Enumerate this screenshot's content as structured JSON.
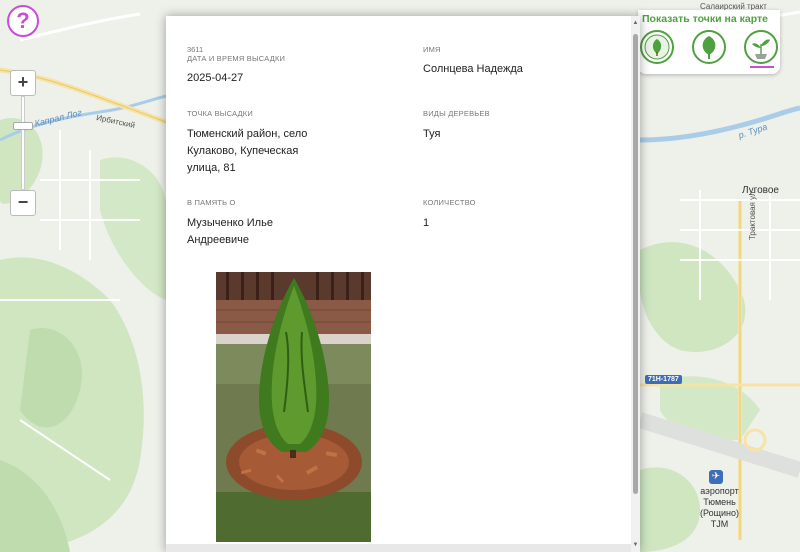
{
  "app": {
    "help_label": "?",
    "zoom_in_label": "+",
    "zoom_out_label": "−"
  },
  "points_panel": {
    "title": "Показать точки на карте",
    "icons": [
      "badge-icon",
      "tree-icon",
      "sapling-icon"
    ],
    "accent_color": "#4fa041",
    "active_underline_color": "#c64fd6"
  },
  "map": {
    "labels": {
      "road_irbit": "Ирбитский",
      "river_kapral": "Капрал Лог",
      "tract": "Салаирский тракт",
      "river_tura": "р. Тура",
      "lugovoe": "Луговое",
      "traktovaya": "Трактовая ул.",
      "road_code": "71Н-1787",
      "airport": "аэропорт\nТюмень\n(Рощино)\nTJM"
    }
  },
  "record": {
    "id": "3611",
    "planting_date_label": "Дата и время высадки",
    "planting_date": "2025-04-27",
    "name_label": "Имя",
    "name": "Солнцева Надежда",
    "location_label": "Точка высадки",
    "location": "Тюменский район, село Кулаково, Купеческая улица, 81",
    "tree_kind_label": "Виды деревьев",
    "tree_kind": "Туя",
    "memory_label": "В память о",
    "memory": "Музыченко Илье Андреевиче",
    "quantity_label": "Количество",
    "quantity": "1"
  }
}
